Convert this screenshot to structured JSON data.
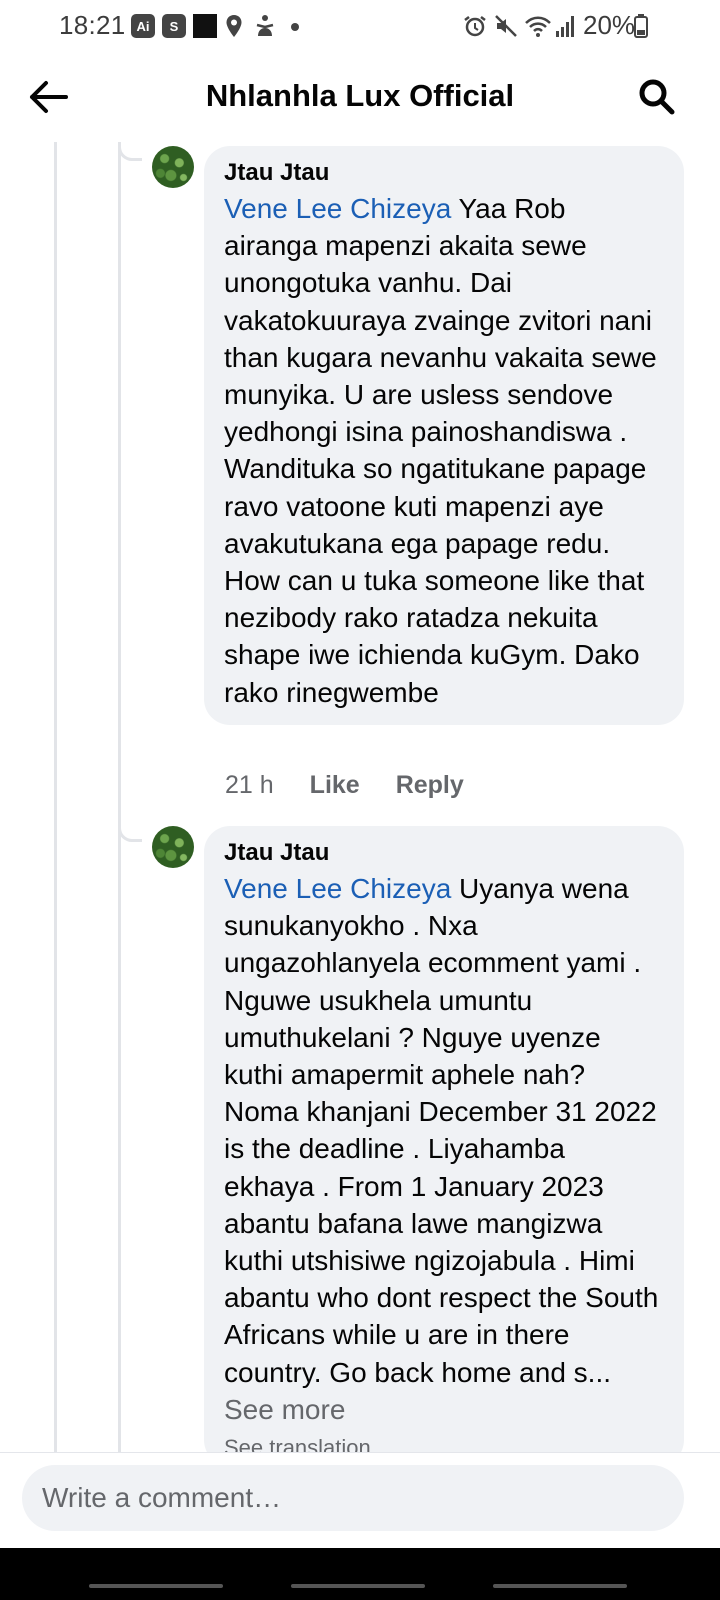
{
  "status_bar": {
    "time": "18:21",
    "app_badges": [
      "Ai",
      "S"
    ],
    "battery": "20%"
  },
  "header": {
    "title": "Nhlanhla Lux Official",
    "back_icon": "arrow-left-icon",
    "search_icon": "search-icon"
  },
  "comments": [
    {
      "author": "Jtau Jtau",
      "mention": "Vene Lee Chizeya",
      "text": " Yaa Rob airanga mapenzi akaita sewe unongotuka vanhu. Dai vakatokuuraya zvainge zvitori nani than kugara nevanhu vakaita sewe munyika. U are usless sendove yedhongi isina painoshandiswa . Wandituka so ngatitukane papage ravo vatoone kuti mapenzi aye avakutukana ega papage redu. How can u tuka someone like that nezibody rako ratadza nekuita shape iwe ichienda kuGym. Dako rako rinegwembe",
      "time": "21 h",
      "like_label": "Like",
      "reply_label": "Reply"
    },
    {
      "author": "Jtau Jtau",
      "mention": "Vene Lee Chizeya",
      "text": " Uyanya wena sunukanyokho . Nxa ungazohlanyela ecomment yami . Nguwe usukhela umuntu umuthukelani ? Nguye uyenze kuthi amapermit aphele nah? Noma khanjani December 31 2022 is the deadline . Liyahamba ekhaya . From 1 January  2023 abantu bafana lawe mangizwa kuthi utshisiwe ngizojabula . Himi abantu who dont respect the South Africans while u are in there country. Go back home and s... ",
      "see_more": "See more",
      "see_translation": "See translation"
    }
  ],
  "composer": {
    "placeholder": "Write a comment…"
  }
}
